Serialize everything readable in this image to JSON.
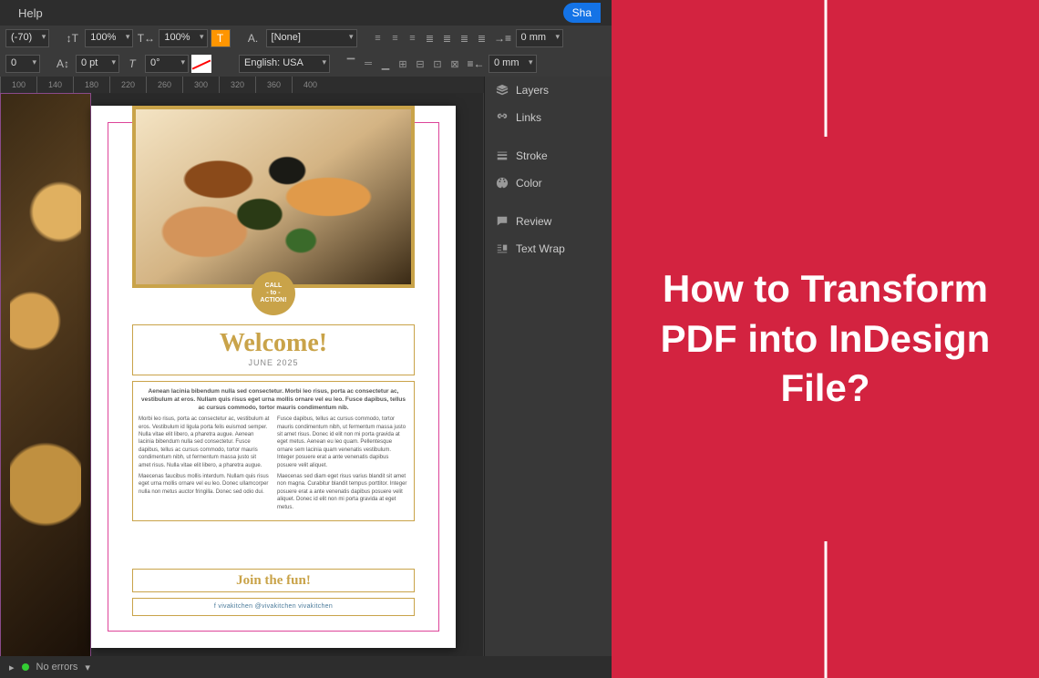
{
  "menu": {
    "help": "Help",
    "share": "Sha"
  },
  "toolbar": {
    "row1": {
      "chars": "(-70)",
      "t_size_pct": "100%",
      "t_horiz_pct": "100%",
      "char_style": "[None]",
      "indent": "0 mm"
    },
    "row2": {
      "leading": "0",
      "tracking": "0 pt",
      "skew": "0°",
      "lang": "English: USA",
      "indent2": "0 mm"
    }
  },
  "ruler": {
    "ticks": [
      "100",
      "140",
      "180",
      "220",
      "260",
      "300",
      "320",
      "360",
      "400"
    ]
  },
  "panels": [
    {
      "icon": "layers",
      "label": "Layers"
    },
    {
      "icon": "links",
      "label": "Links"
    },
    {
      "icon": "stroke",
      "label": "Stroke"
    },
    {
      "icon": "color",
      "label": "Color"
    },
    {
      "icon": "review",
      "label": "Review"
    },
    {
      "icon": "textwrap",
      "label": "Text Wrap"
    }
  ],
  "document": {
    "cta_top": "CALL",
    "cta_mid": "- to -",
    "cta_bot": "ACTION!",
    "welcome_title": "Welcome!",
    "welcome_sub": "JUNE 2025",
    "intro": "Aenean lacinia bibendum nulla sed consectetur. Morbi leo risus, porta ac consectetur ac, vestibulum at eros. Nullam quis risus eget urna mollis ornare vel eu leo. Fusce dapibus, tellus ac cursus commodo, tortor mauris condimentum nib.",
    "col_left_p1": "Morbi leo risus, porta ac consectetur ac, vestibulum at eros. Vestibulum id ligula porta felis euismod semper. Nulla vitae elit libero, a pharetra augue. Aenean lacinia bibendum nulla sed consectetur. Fusce dapibus, tellus ac cursus commodo, tortor mauris condimentum nibh, ut fermentum massa justo sit amet risus. Nulla vitae elit libero, a pharetra augue.",
    "col_left_p2": "Maecenas faucibus mollis interdum. Nullam quis risus eget urna mollis ornare vel eu leo. Donec ullamcorper nulla non metus auctor fringilla. Donec sed odio dui.",
    "col_right_p1": "Fusce dapibus, tellus ac cursus commodo, tortor mauris condimentum nibh, ut fermentum massa justo sit amet risus. Donec id elit non mi porta gravida at eget metus. Aenean eu leo quam. Pellentesque ornare sem lacinia quam venenatis vestibulum. Integer posuere erat a ante venenatis dapibus posuere velit aliquet.",
    "col_right_p2": "Maecenas sed diam eget risus varius blandit sit amet non magna. Curabitur blandit tempus porttitor. Integer posuere erat a ante venenatis dapibus posuere velit aliquet. Donec id elit non mi porta gravida at eget metus.",
    "join": "Join the fun!",
    "social": "f vivakitchen  @vivakitchen  vivakitchen"
  },
  "status": {
    "errors": "No errors"
  },
  "banner": {
    "title": "How to Transform PDF into InDesign File?"
  }
}
